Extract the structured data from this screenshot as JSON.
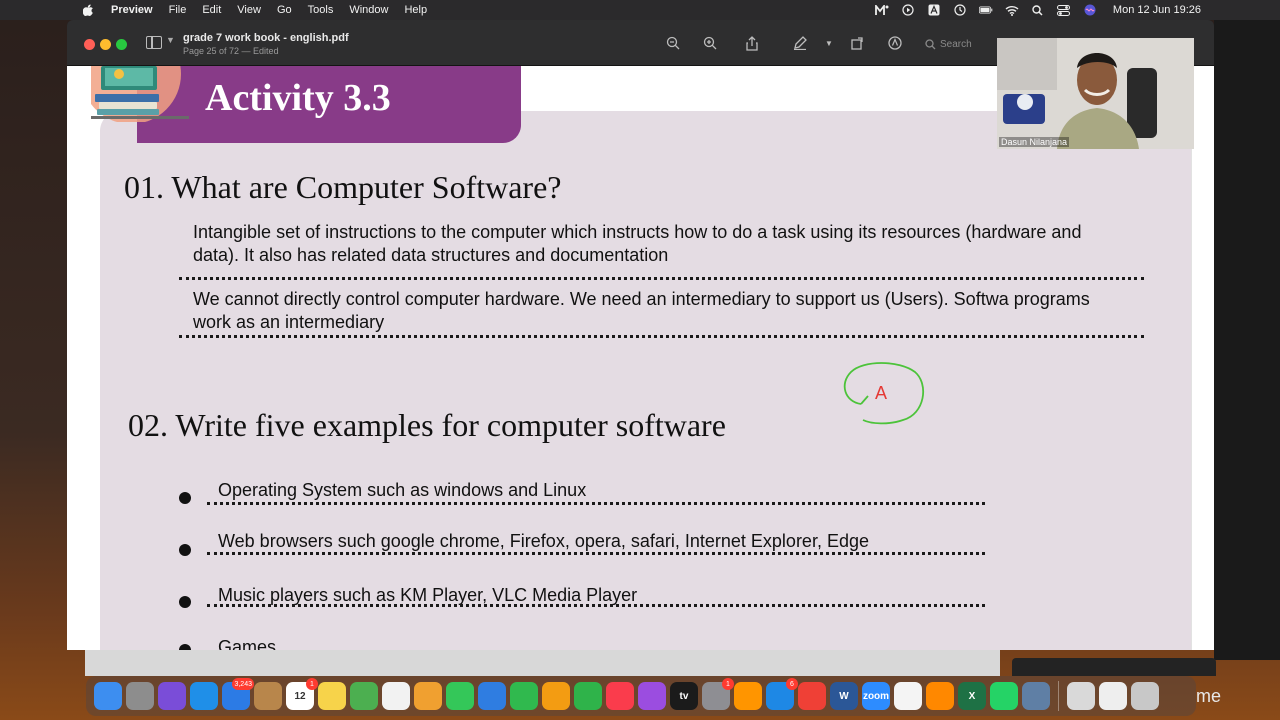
{
  "menubar": {
    "app_name": "Preview",
    "items": [
      "File",
      "Edit",
      "View",
      "Go",
      "Tools",
      "Window",
      "Help"
    ],
    "status_icons": [
      "meet-icon",
      "play-icon",
      "text-icon",
      "clock-icon",
      "battery-icon",
      "wifi-icon",
      "search-icon",
      "control-center-icon",
      "siri-icon"
    ],
    "clock": "Mon 12 Jun  19:26"
  },
  "window": {
    "doc_title": "grade 7 work book - english.pdf",
    "doc_subtitle": "Page 25 of 72 — Edited",
    "search_placeholder": "Search",
    "toolbar_icons": [
      "zoom-out-icon",
      "zoom-in-icon",
      "share-icon",
      "markup-pen-icon",
      "rotate-icon",
      "annotate-icon"
    ]
  },
  "page": {
    "activity_title": "Activity 3.3",
    "q1": {
      "heading": "01. What are Computer Software?",
      "answers": [
        "Intangible set of instructions to the computer which instructs how to do a task using its resources (hardware and data). It also has related data structures and documentation",
        "We cannot directly control computer hardware. We need an intermediary to support us (Users). Softwa programs work as an intermediary"
      ]
    },
    "q2": {
      "heading": "02. Write five examples for computer software",
      "items": [
        "Operating System such as windows and Linux",
        "Web browsers such google chrome, Firefox, opera, safari, Internet Explorer, Edge",
        "Music players such as KM Player, VLC Media Player",
        "Games"
      ]
    },
    "annotation": {
      "letter": "A",
      "circle_color": "#4cc33a",
      "letter_color": "#e53935"
    },
    "banner_color": "#883b88",
    "panel_color": "#e4dce3"
  },
  "webcam": {
    "participant_name": "Dasun Nilanjana"
  },
  "dock": {
    "apps": [
      {
        "name": "finder",
        "color": "#3d8ef0"
      },
      {
        "name": "launchpad",
        "color": "#8d8d8d"
      },
      {
        "name": "siri",
        "color": "#7a4dd8"
      },
      {
        "name": "safari",
        "color": "#1f8fe8"
      },
      {
        "name": "mail",
        "color": "#2c7be5",
        "badge": "3,243"
      },
      {
        "name": "contacts",
        "color": "#b8864b"
      },
      {
        "name": "calendar",
        "color": "#ffffff",
        "label": "12",
        "badge": "1"
      },
      {
        "name": "notes",
        "color": "#f7d34a"
      },
      {
        "name": "maps",
        "color": "#4caf50"
      },
      {
        "name": "reminders",
        "color": "#f2f2f2"
      },
      {
        "name": "photos",
        "color": "#f0a030"
      },
      {
        "name": "messages",
        "color": "#34c759"
      },
      {
        "name": "keynote",
        "color": "#2f7de1"
      },
      {
        "name": "facetime",
        "color": "#30b94e"
      },
      {
        "name": "pages",
        "color": "#f39c12"
      },
      {
        "name": "numbers",
        "color": "#2fb34a"
      },
      {
        "name": "music",
        "color": "#fa3c4c"
      },
      {
        "name": "podcasts",
        "color": "#9b4de0"
      },
      {
        "name": "tv",
        "color": "#1b1b1b",
        "label": "tv"
      },
      {
        "name": "system-settings",
        "color": "#8e8e93",
        "badge": "1"
      },
      {
        "name": "books",
        "color": "#ff9500"
      },
      {
        "name": "app-store",
        "color": "#1e88e5",
        "badge": "6"
      },
      {
        "name": "anydesk",
        "color": "#ef4036"
      },
      {
        "name": "word",
        "color": "#2b5797",
        "label": "W"
      },
      {
        "name": "zoom",
        "color": "#2d8cff",
        "label": "zoom"
      },
      {
        "name": "chrome",
        "color": "#f4f4f4"
      },
      {
        "name": "vlc",
        "color": "#ff8800"
      },
      {
        "name": "excel",
        "color": "#1e7145",
        "label": "X"
      },
      {
        "name": "whatsapp",
        "color": "#25d366"
      },
      {
        "name": "screen-share",
        "color": "#5f7fa5"
      }
    ],
    "right_items": [
      {
        "name": "documents-stack",
        "color": "#d9d9d9"
      },
      {
        "name": "downloads-stack",
        "color": "#eeeeee"
      },
      {
        "name": "trash",
        "color": "#c8c8c8"
      }
    ],
    "overflow_text": "me"
  }
}
